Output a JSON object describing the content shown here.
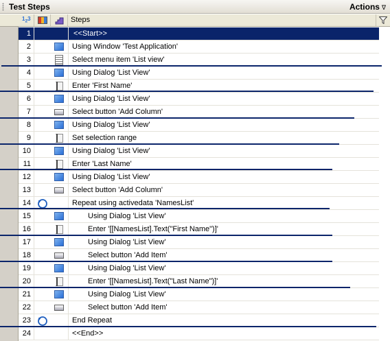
{
  "panel": {
    "title": "Test Steps",
    "actions_label": "Actions",
    "actions_arrow": "∇"
  },
  "grid": {
    "columns": {
      "steps": "Steps"
    },
    "header_icons": [
      "numbering-icon",
      "bricks-icon",
      "staircase-icon",
      "filter-icon"
    ]
  },
  "rows": [
    {
      "num": "1",
      "icon": "none",
      "indent": 0,
      "text": "<<Start>>",
      "selected": true
    },
    {
      "num": "2",
      "icon": "window",
      "indent": 0,
      "text": "Using Window 'Test Application'"
    },
    {
      "num": "3",
      "icon": "menu",
      "indent": 0,
      "text": "Select menu item 'List view'"
    },
    {
      "num": "4",
      "icon": "window",
      "indent": 0,
      "text": "Using Dialog 'List View'"
    },
    {
      "num": "5",
      "icon": "edit",
      "indent": 0,
      "text": "Enter 'First Name'"
    },
    {
      "num": "6",
      "icon": "window",
      "indent": 0,
      "text": "Using Dialog 'List View'"
    },
    {
      "num": "7",
      "icon": "button",
      "indent": 0,
      "text": "Select button 'Add Column'"
    },
    {
      "num": "8",
      "icon": "window",
      "indent": 0,
      "text": "Using Dialog 'List View'"
    },
    {
      "num": "9",
      "icon": "edit",
      "indent": 0,
      "text": "Set selection range"
    },
    {
      "num": "10",
      "icon": "window",
      "indent": 0,
      "text": "Using Dialog 'List View'"
    },
    {
      "num": "11",
      "icon": "edit",
      "indent": 0,
      "text": "Enter 'Last Name'"
    },
    {
      "num": "12",
      "icon": "window",
      "indent": 0,
      "text": "Using Dialog 'List View'"
    },
    {
      "num": "13",
      "icon": "button",
      "indent": 0,
      "text": "Select button 'Add Column'"
    },
    {
      "num": "14",
      "icon": "repeat",
      "indent": 0,
      "text": "Repeat using activedata 'NamesList'"
    },
    {
      "num": "15",
      "icon": "window",
      "indent": 1,
      "text": "Using Dialog 'List View'"
    },
    {
      "num": "16",
      "icon": "edit",
      "indent": 1,
      "text": "Enter '[[NamesList].Text(\"First Name\")]'"
    },
    {
      "num": "17",
      "icon": "window",
      "indent": 1,
      "text": "Using Dialog 'List View'"
    },
    {
      "num": "18",
      "icon": "button",
      "indent": 1,
      "text": "Select button 'Add Item'"
    },
    {
      "num": "19",
      "icon": "window",
      "indent": 1,
      "text": "Using Dialog 'List View'"
    },
    {
      "num": "20",
      "icon": "edit",
      "indent": 1,
      "text": "Enter '[[NamesList].Text(\"Last Name\")]'"
    },
    {
      "num": "21",
      "icon": "window",
      "indent": 1,
      "text": "Using Dialog 'List View'"
    },
    {
      "num": "22",
      "icon": "button",
      "indent": 1,
      "text": "Select button 'Add Item'"
    },
    {
      "num": "23",
      "icon": "repeat",
      "indent": 0,
      "text": "End Repeat"
    },
    {
      "num": "24",
      "icon": "none",
      "indent": 0,
      "text": "<<End>>"
    }
  ],
  "colors": {
    "selection": "#0a246a",
    "divider": "#0a246a",
    "header_bg": "#ece9d8"
  }
}
